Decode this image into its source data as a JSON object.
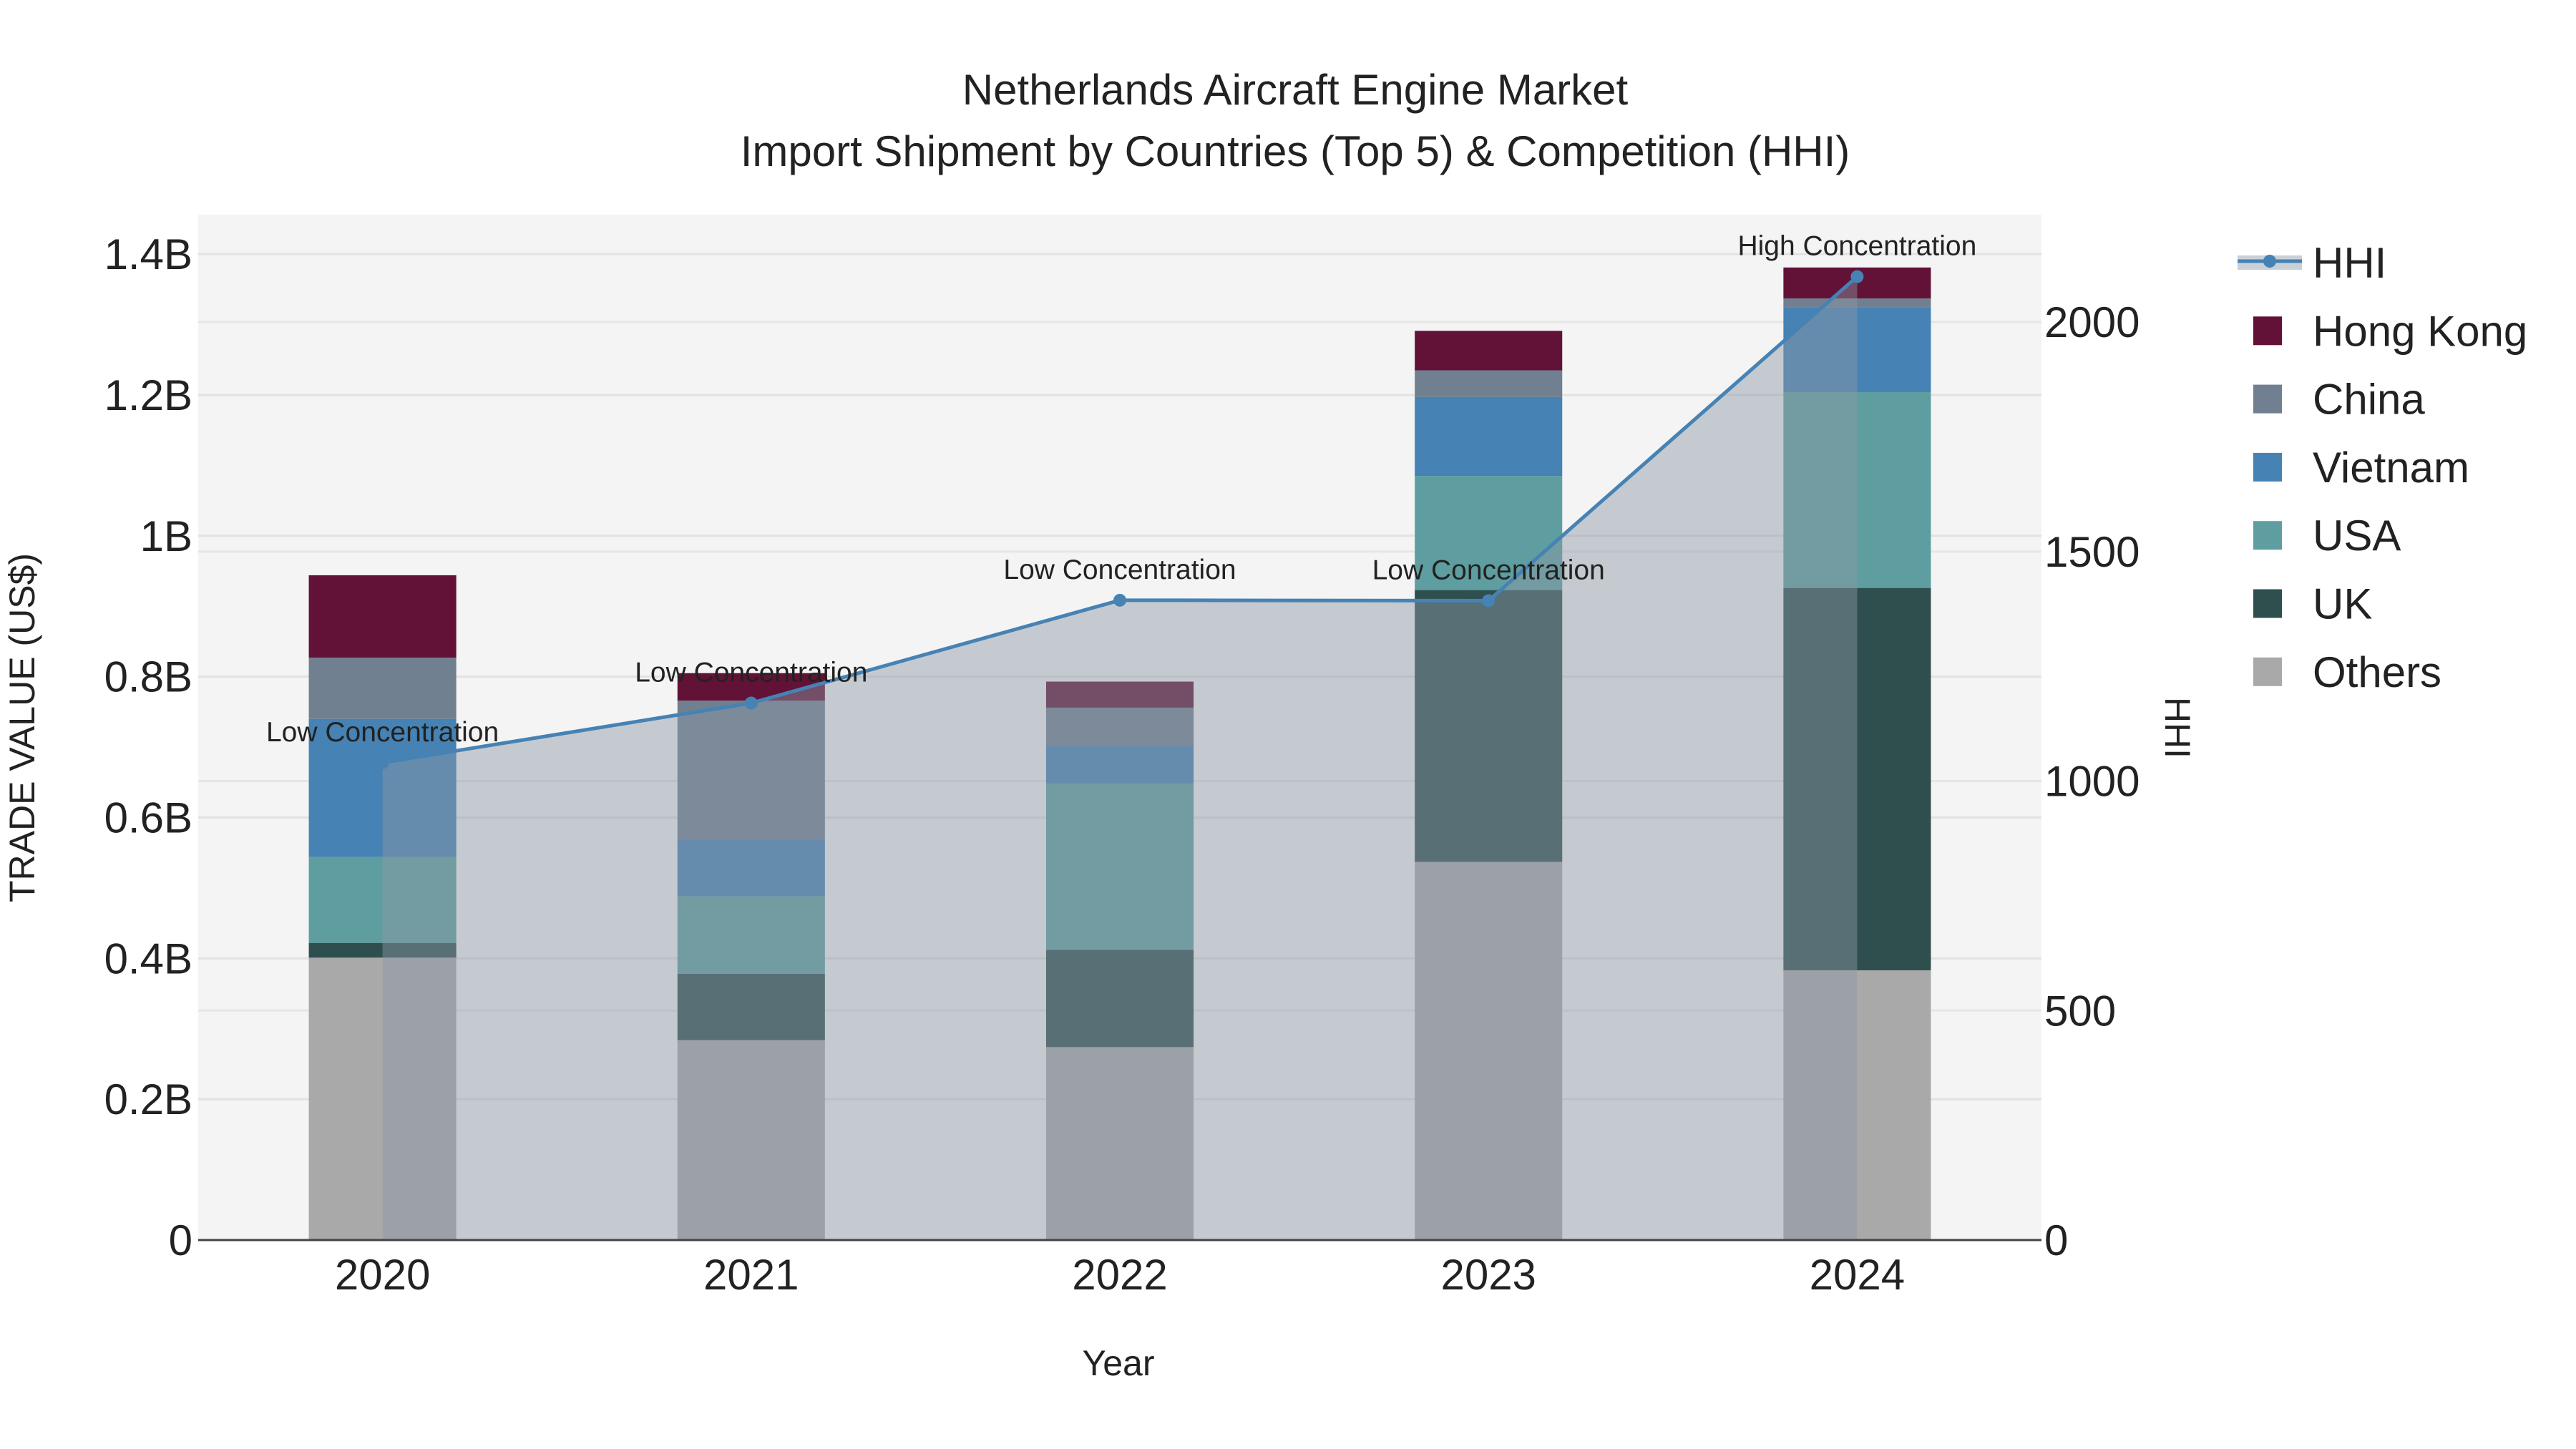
{
  "chart_data": {
    "type": "bar",
    "title": "Netherlands Aircraft Engine Market",
    "subtitle": "Import Shipment by Countries (Top 5) & Competition (HHI)",
    "xlabel": "Year",
    "ylabel": "TRADE VALUE (US$)",
    "y2label": "HHI",
    "categories": [
      "2020",
      "2021",
      "2022",
      "2023",
      "2024"
    ],
    "ylim": [
      0,
      1.456
    ],
    "y_unit": "B US$",
    "yticks": [
      0,
      0.2,
      0.4,
      0.6,
      0.8,
      1.0,
      1.2,
      1.4
    ],
    "ytick_labels": [
      "0",
      "0.2B",
      "0.4B",
      "0.6B",
      "0.8B",
      "1B",
      "1.2B",
      "1.4B"
    ],
    "y2lim": [
      0,
      2234
    ],
    "y2ticks": [
      0,
      500,
      1000,
      1500,
      2000
    ],
    "y2tick_labels": [
      "0",
      "500",
      "1000",
      "1500",
      "2000"
    ],
    "grid": true,
    "legend_position": "right",
    "stack_order_bottom_to_top": [
      "Others",
      "UK",
      "USA",
      "Vietnam",
      "China",
      "Hong Kong"
    ],
    "series": [
      {
        "name": "Others",
        "color": "#a9a9a9",
        "values": [
          0.401,
          0.284,
          0.274,
          0.537,
          0.383
        ]
      },
      {
        "name": "UK",
        "color": "#2f4f4f",
        "values": [
          0.021,
          0.094,
          0.138,
          0.386,
          0.543
        ]
      },
      {
        "name": "USA",
        "color": "#5f9ea0",
        "values": [
          0.122,
          0.11,
          0.236,
          0.162,
          0.278
        ]
      },
      {
        "name": "Vietnam",
        "color": "#4682b4",
        "values": [
          0.196,
          0.08,
          0.054,
          0.112,
          0.12
        ]
      },
      {
        "name": "China",
        "color": "#708090",
        "values": [
          0.087,
          0.198,
          0.054,
          0.038,
          0.013
        ]
      },
      {
        "name": "Hong Kong",
        "color": "#621236",
        "values": [
          0.117,
          0.039,
          0.037,
          0.056,
          0.044
        ]
      }
    ],
    "hhi": {
      "name": "HHI",
      "color": "#4682b4",
      "values": [
        1040,
        1170,
        1394,
        1393,
        2099
      ],
      "annotations": [
        "Low Concentration",
        "Low Concentration",
        "Low Concentration",
        "Low Concentration",
        "High Concentration"
      ]
    },
    "legend": [
      "HHI",
      "Hong Kong",
      "China",
      "Vietnam",
      "USA",
      "UK",
      "Others"
    ]
  }
}
